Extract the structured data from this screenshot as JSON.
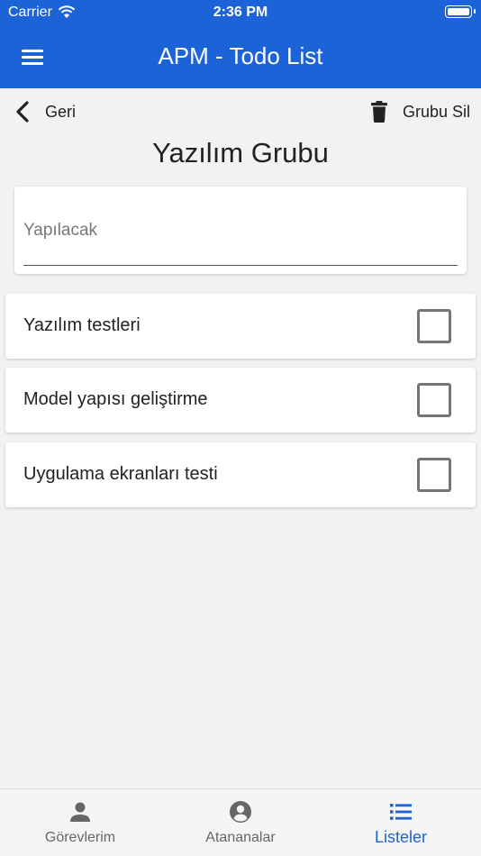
{
  "status_bar": {
    "carrier": "Carrier",
    "time": "2:36 PM",
    "battery_level": 1.0
  },
  "app_bar": {
    "title": "APM - Todo List",
    "menu_icon": "hamburger-menu-icon"
  },
  "sub_nav": {
    "back_label": "Geri",
    "back_icon": "chevron-left-icon",
    "delete_label": "Grubu Sil",
    "delete_icon": "trash-icon"
  },
  "page_title": "Yazılım Grubu",
  "new_todo": {
    "placeholder": "Yapılacak",
    "value": ""
  },
  "todos": [
    {
      "label": "Yazılım testleri",
      "checked": false
    },
    {
      "label": "Model yapısı geliştirme",
      "checked": false
    },
    {
      "label": "Uygulama ekranları testi",
      "checked": false
    }
  ],
  "tab_bar": {
    "tabs": [
      {
        "label": "Görevlerim",
        "icon": "person-icon",
        "active": false
      },
      {
        "label": "Atananalar",
        "icon": "account-circle-icon",
        "active": false
      },
      {
        "label": "Listeler",
        "icon": "list-icon",
        "active": true
      }
    ]
  },
  "colors": {
    "primary": "#1d63d8",
    "background": "#f2f2f2",
    "checkbox_border": "#757575"
  }
}
